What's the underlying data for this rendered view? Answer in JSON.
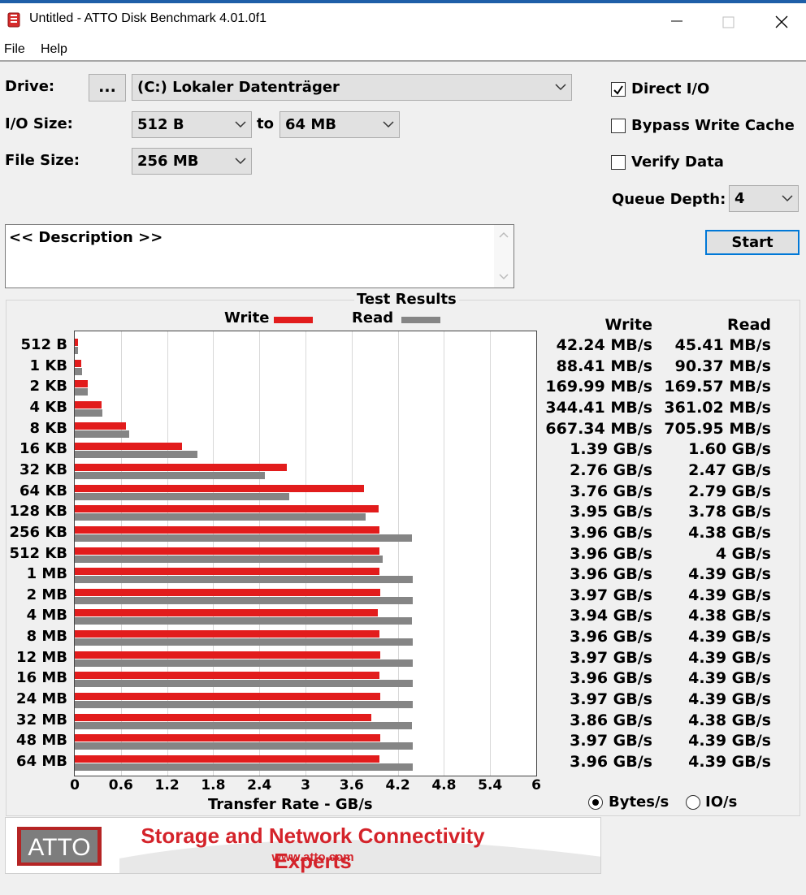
{
  "window": {
    "title": "Untitled - ATTO Disk Benchmark 4.01.0f1"
  },
  "menu": [
    "File",
    "Help"
  ],
  "form": {
    "drive_label": "Drive:",
    "browse_label": "...",
    "drive_value": "(C:) Lokaler Datenträger",
    "io_size_label": "I/O Size:",
    "io_from": "512 B",
    "to_label": "to",
    "io_to": "64 MB",
    "file_size_label": "File Size:",
    "file_size": "256 MB",
    "direct_io_label": "Direct I/O",
    "direct_io_checked": true,
    "bypass_label": "Bypass Write Cache",
    "bypass_checked": false,
    "verify_label": "Verify Data",
    "verify_checked": false,
    "queue_depth_label": "Queue Depth:",
    "queue_depth": "4",
    "start_label": "Start",
    "description": "<< Description >>"
  },
  "results": {
    "title": "Test Results",
    "write_header": "Write",
    "read_header": "Read",
    "units_bytes": "Bytes/s",
    "units_io": "IO/s",
    "units_selected": "bytes",
    "rows": [
      {
        "size": "512 B",
        "write": "42.24 MB/s",
        "read": "45.41 MB/s"
      },
      {
        "size": "1 KB",
        "write": "88.41 MB/s",
        "read": "90.37 MB/s"
      },
      {
        "size": "2 KB",
        "write": "169.99 MB/s",
        "read": "169.57 MB/s"
      },
      {
        "size": "4 KB",
        "write": "344.41 MB/s",
        "read": "361.02 MB/s"
      },
      {
        "size": "8 KB",
        "write": "667.34 MB/s",
        "read": "705.95 MB/s"
      },
      {
        "size": "16 KB",
        "write": "1.39 GB/s",
        "read": "1.60 GB/s"
      },
      {
        "size": "32 KB",
        "write": "2.76 GB/s",
        "read": "2.47 GB/s"
      },
      {
        "size": "64 KB",
        "write": "3.76 GB/s",
        "read": "2.79 GB/s"
      },
      {
        "size": "128 KB",
        "write": "3.95 GB/s",
        "read": "3.78 GB/s"
      },
      {
        "size": "256 KB",
        "write": "3.96 GB/s",
        "read": "4.38 GB/s"
      },
      {
        "size": "512 KB",
        "write": "3.96 GB/s",
        "read": "4 GB/s"
      },
      {
        "size": "1 MB",
        "write": "3.96 GB/s",
        "read": "4.39 GB/s"
      },
      {
        "size": "2 MB",
        "write": "3.97 GB/s",
        "read": "4.39 GB/s"
      },
      {
        "size": "4 MB",
        "write": "3.94 GB/s",
        "read": "4.38 GB/s"
      },
      {
        "size": "8 MB",
        "write": "3.96 GB/s",
        "read": "4.39 GB/s"
      },
      {
        "size": "12 MB",
        "write": "3.97 GB/s",
        "read": "4.39 GB/s"
      },
      {
        "size": "16 MB",
        "write": "3.96 GB/s",
        "read": "4.39 GB/s"
      },
      {
        "size": "24 MB",
        "write": "3.97 GB/s",
        "read": "4.39 GB/s"
      },
      {
        "size": "32 MB",
        "write": "3.86 GB/s",
        "read": "4.38 GB/s"
      },
      {
        "size": "48 MB",
        "write": "3.97 GB/s",
        "read": "4.39 GB/s"
      },
      {
        "size": "64 MB",
        "write": "3.96 GB/s",
        "read": "4.39 GB/s"
      }
    ]
  },
  "chart_data": {
    "type": "bar",
    "orientation": "horizontal",
    "categories": [
      "512 B",
      "1 KB",
      "2 KB",
      "4 KB",
      "8 KB",
      "16 KB",
      "32 KB",
      "64 KB",
      "128 KB",
      "256 KB",
      "512 KB",
      "1 MB",
      "2 MB",
      "4 MB",
      "8 MB",
      "12 MB",
      "16 MB",
      "24 MB",
      "32 MB",
      "48 MB",
      "64 MB"
    ],
    "series": [
      {
        "name": "Write",
        "color": "#e21c1c",
        "values": [
          0.04224,
          0.08841,
          0.16999,
          0.34441,
          0.66734,
          1.39,
          2.76,
          3.76,
          3.95,
          3.96,
          3.96,
          3.96,
          3.97,
          3.94,
          3.96,
          3.97,
          3.96,
          3.97,
          3.86,
          3.97,
          3.96
        ]
      },
      {
        "name": "Read",
        "color": "#858585",
        "values": [
          0.04541,
          0.09037,
          0.16957,
          0.36102,
          0.70595,
          1.6,
          2.47,
          2.79,
          3.78,
          4.38,
          4.0,
          4.39,
          4.39,
          4.38,
          4.39,
          4.39,
          4.39,
          4.39,
          4.38,
          4.39,
          4.39
        ]
      }
    ],
    "xlabel": "Transfer Rate - GB/s",
    "xlim": [
      0,
      6
    ],
    "xticks": [
      "0",
      "0.6",
      "1.2",
      "1.8",
      "2.4",
      "3",
      "3.6",
      "4.2",
      "4.8",
      "5.4",
      "6"
    ],
    "grid": true,
    "legend": "top"
  },
  "banner": {
    "logo": "ATTO",
    "slogan": "Storage and Network Connectivity Experts",
    "url": "www.atto.com"
  }
}
